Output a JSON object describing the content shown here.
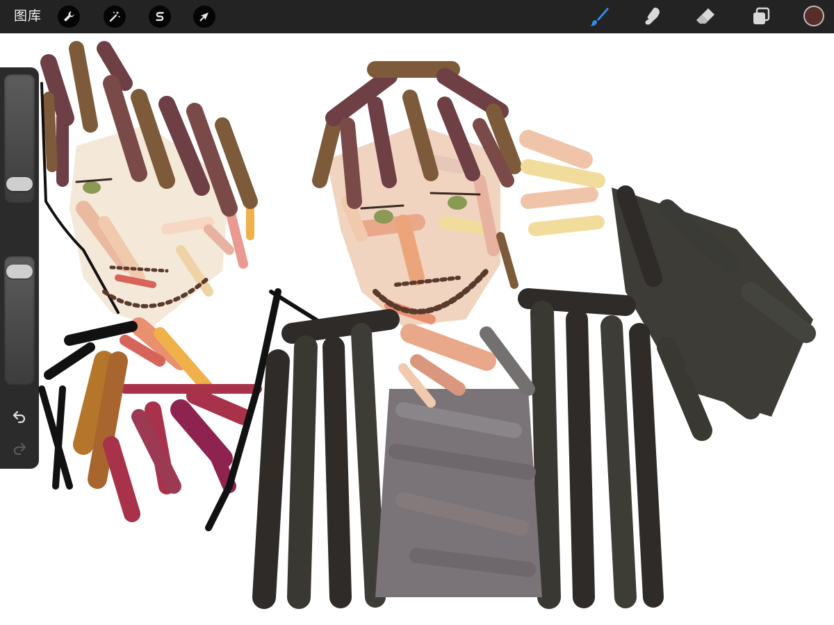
{
  "toolbar": {
    "gallery_label": "图库",
    "actions_icon": "wrench-icon",
    "adjustments_icon": "magic-wand-icon",
    "selection_icon": "selection-s-icon",
    "transform_icon": "arrow-cursor-icon",
    "brush_icon": "paintbrush-icon",
    "smudge_icon": "smudge-finger-icon",
    "eraser_icon": "eraser-icon",
    "layers_icon": "layers-icon",
    "current_color": "#5a2e28",
    "active_tool": "brush",
    "active_color": "#2f8ff0"
  },
  "sidebar": {
    "brush_size_level": 0.92,
    "brush_opacity_level": 0.04,
    "modify_icon": "square-icon",
    "undo_icon": "undo-arrow-icon",
    "redo_icon": "redo-arrow-icon"
  },
  "canvas": {
    "background": "#ffffff",
    "palette": {
      "hair": "#6e3f44",
      "hair_light": "#7c5a3a",
      "skin": "#e8b79a",
      "skin_light": "#f2d3b6",
      "jacket_dark": "#2f2b28",
      "jacket_mid": "#3d3c37",
      "shirt_gray": "#7a7478",
      "magenta": "#8e2350",
      "ochre": "#b5752a",
      "eye_green": "#8a9a55"
    }
  }
}
